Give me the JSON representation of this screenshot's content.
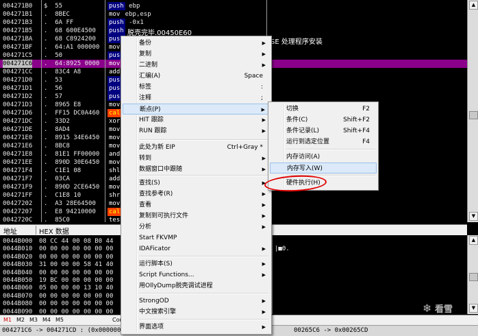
{
  "disasm": {
    "rows": [
      {
        "addr": "004271B0",
        "hex": "$  55",
        "op": "push",
        "rest": " ebp",
        "opstyle": "push"
      },
      {
        "addr": "004271B1",
        "hex": ".  8BEC",
        "op": "mov",
        "rest": " ebp,esp",
        "opstyle": "plain"
      },
      {
        "addr": "004271B3",
        "hex": ".  6A FF",
        "op": "push",
        "rest": " -0x1",
        "opstyle": "push"
      },
      {
        "addr": "004271B5",
        "hex": ".  68 600E4500",
        "op": "push",
        "rest": "",
        "opstyle": "push"
      },
      {
        "addr": "004271BA",
        "hex": ".  68 C8924200",
        "op": "push",
        "rest": "",
        "opstyle": "push"
      },
      {
        "addr": "004271BF",
        "hex": ".  64:A1 000000",
        "op": "mov",
        "rest": "",
        "opstyle": "plain"
      },
      {
        "addr": "004271C5",
        "hex": ".  50",
        "op": "push",
        "rest": "",
        "opstyle": "push"
      },
      {
        "addr": "004271C6",
        "hex": ".  64:8925 0000",
        "op": "mov",
        "rest": "",
        "opstyle": "plain"
      },
      {
        "addr": "004271CC",
        "hex": ".  83C4 A8",
        "op": "add",
        "rest": "",
        "opstyle": "plain"
      },
      {
        "addr": "004271D0",
        "hex": ".  53",
        "op": "push",
        "rest": "",
        "opstyle": "push"
      },
      {
        "addr": "004271D1",
        "hex": ".  56",
        "op": "push",
        "rest": "",
        "opstyle": "push"
      },
      {
        "addr": "004271D2",
        "hex": ".  57",
        "op": "push",
        "rest": "",
        "opstyle": "push"
      },
      {
        "addr": "004271D3",
        "hex": ".  8965 E8",
        "op": "mov",
        "rest": "",
        "opstyle": "plain"
      },
      {
        "addr": "004271D6",
        "hex": ".  FF15 DC0A460",
        "op": "call",
        "rest": "",
        "opstyle": "call"
      },
      {
        "addr": "004271DC",
        "hex": ".  33D2",
        "op": "xor",
        "rest": "",
        "opstyle": "plain"
      },
      {
        "addr": "004271DE",
        "hex": ".  8AD4",
        "op": "mov",
        "rest": "",
        "opstyle": "plain"
      },
      {
        "addr": "004271E0",
        "hex": ".  8915 34E6450",
        "op": "mov",
        "rest": "",
        "opstyle": "plain"
      },
      {
        "addr": "004271E6",
        "hex": ".  8BC8",
        "op": "mov",
        "rest": "",
        "opstyle": "plain"
      },
      {
        "addr": "004271E8",
        "hex": ".  81E1 FF00000",
        "op": "and",
        "rest": "",
        "opstyle": "plain"
      },
      {
        "addr": "004271EE",
        "hex": ".  890D 30E6450",
        "op": "mov",
        "rest": "",
        "opstyle": "plain"
      },
      {
        "addr": "004271F4",
        "hex": ".  C1E1 08",
        "op": "shl",
        "rest": "",
        "opstyle": "plain"
      },
      {
        "addr": "004271F7",
        "hex": ".  03CA",
        "op": "add",
        "rest": "",
        "opstyle": "plain"
      },
      {
        "addr": "004271F9",
        "hex": ".  890D 2CE6450",
        "op": "mov",
        "rest": "",
        "opstyle": "plain"
      },
      {
        "addr": "004271FF",
        "hex": ".  C1E8 10",
        "op": "shr",
        "rest": "",
        "opstyle": "plain"
      },
      {
        "addr": "00427202",
        "hex": ".  A3 28E64500",
        "op": "mov",
        "rest": "",
        "opstyle": "plain"
      },
      {
        "addr": "00427207",
        "hex": ".  E8 94210000",
        "op": "call",
        "rest": "",
        "opstyle": "call"
      },
      {
        "addr": "0042720C",
        "hex": ".  85C0",
        "op": "test",
        "rest": "",
        "opstyle": "plain"
      }
    ],
    "comment1": "脱壳完毕.00450E60",
    "comment2": "SE 处理程序安装"
  },
  "dump": {
    "col_addr": "地址",
    "col_hex": "HEX 数据",
    "rows": [
      {
        "addr": "0044B000",
        "hex": "08 CC 44 00 08 B0 44",
        "asc": ""
      },
      {
        "addr": "0044B010",
        "hex": "00 00 00 00 00 00 00",
        "asc": "|■Θ."
      },
      {
        "addr": "0044B020",
        "hex": "00 00 00 00 00 00 00",
        "asc": ""
      },
      {
        "addr": "0044B030",
        "hex": "31 00 00 00 58 41 40",
        "asc": ""
      },
      {
        "addr": "0044B040",
        "hex": "00 00 00 00 00 00 00",
        "asc": ""
      },
      {
        "addr": "0044B050",
        "hex": "19 BC 00 00 00 00 00",
        "asc": ""
      },
      {
        "addr": "0044B060",
        "hex": "05 00 00 00 13 10 40",
        "asc": ""
      },
      {
        "addr": "0044B070",
        "hex": "00 00 00 00 00 00 00",
        "asc": ""
      },
      {
        "addr": "0044B080",
        "hex": "00 00 00 00 00 00 00",
        "asc": ""
      },
      {
        "addr": "0044B090",
        "hex": "00 00 00 00 00 00 00",
        "asc": ""
      }
    ]
  },
  "tabs": [
    "M1",
    "M2",
    "M3",
    "M4",
    "M5"
  ],
  "tab_extra": "Com",
  "status": {
    "left": "004271C6 -> 004271CD : (0x00000007",
    "right": "00265C6 -> 0x00265CD"
  },
  "watermark": "看雪",
  "context_menu": {
    "items": [
      {
        "label": "备份",
        "shortcut": "",
        "submenu": true
      },
      {
        "label": "复制",
        "shortcut": "",
        "submenu": true
      },
      {
        "label": "二进制",
        "shortcut": "",
        "submenu": true
      },
      {
        "label": "汇编(A)",
        "shortcut": "Space",
        "submenu": false
      },
      {
        "label": "标签",
        "shortcut": ":",
        "submenu": false
      },
      {
        "label": "注释",
        "shortcut": ";",
        "submenu": false
      },
      {
        "label": "断点(P)",
        "shortcut": "",
        "submenu": true
      },
      {
        "label": "HIT 跟踪",
        "shortcut": "",
        "submenu": true
      },
      {
        "label": "RUN 跟踪",
        "shortcut": "",
        "submenu": true
      },
      {
        "label": "此处为新 EIP",
        "shortcut": "Ctrl+Gray *",
        "submenu": false
      },
      {
        "label": "转到",
        "shortcut": "",
        "submenu": true
      },
      {
        "label": "数据窗口中跟随",
        "shortcut": "",
        "submenu": true
      },
      {
        "label": "查找(S)",
        "shortcut": "",
        "submenu": true
      },
      {
        "label": "查找参考(R)",
        "shortcut": "",
        "submenu": true
      },
      {
        "label": "查看",
        "shortcut": "",
        "submenu": true
      },
      {
        "label": "复制到可执行文件",
        "shortcut": "",
        "submenu": true
      },
      {
        "label": "分析",
        "shortcut": "",
        "submenu": true
      },
      {
        "label": "Start FKVMP",
        "shortcut": "",
        "submenu": false
      },
      {
        "label": "IDAFicator",
        "shortcut": "",
        "submenu": true
      },
      {
        "label": "运行脚本(S)",
        "shortcut": "",
        "submenu": true
      },
      {
        "label": "Script Functions...",
        "shortcut": "",
        "submenu": true
      },
      {
        "label": "用OllyDump脱壳调试进程",
        "shortcut": "",
        "submenu": false
      },
      {
        "label": "StrongOD",
        "shortcut": "",
        "submenu": true
      },
      {
        "label": "中文搜索引擎",
        "shortcut": "",
        "submenu": true
      },
      {
        "label": "界面选项",
        "shortcut": "",
        "submenu": true
      }
    ]
  },
  "breakpoint_submenu": {
    "items": [
      {
        "label": "切换",
        "shortcut": "F2"
      },
      {
        "label": "条件(C)",
        "shortcut": "Shift+F2"
      },
      {
        "label": "条件记录(L)",
        "shortcut": "Shift+F4"
      },
      {
        "label": "运行到选定位置",
        "shortcut": "F4"
      },
      {
        "label": "内存访问(A)",
        "shortcut": ""
      },
      {
        "label": "内存写入(W)",
        "shortcut": ""
      },
      {
        "label": "硬件执行(H)",
        "shortcut": ""
      }
    ]
  }
}
